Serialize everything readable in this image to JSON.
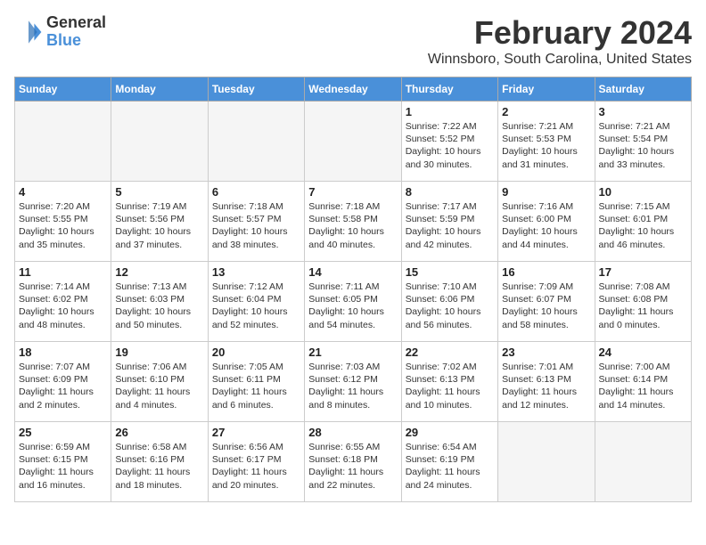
{
  "logo": {
    "general": "General",
    "blue": "Blue"
  },
  "title": "February 2024",
  "subtitle": "Winnsboro, South Carolina, United States",
  "days_header": [
    "Sunday",
    "Monday",
    "Tuesday",
    "Wednesday",
    "Thursday",
    "Friday",
    "Saturday"
  ],
  "weeks": [
    [
      {
        "num": "",
        "info": ""
      },
      {
        "num": "",
        "info": ""
      },
      {
        "num": "",
        "info": ""
      },
      {
        "num": "",
        "info": ""
      },
      {
        "num": "1",
        "info": "Sunrise: 7:22 AM\nSunset: 5:52 PM\nDaylight: 10 hours\nand 30 minutes."
      },
      {
        "num": "2",
        "info": "Sunrise: 7:21 AM\nSunset: 5:53 PM\nDaylight: 10 hours\nand 31 minutes."
      },
      {
        "num": "3",
        "info": "Sunrise: 7:21 AM\nSunset: 5:54 PM\nDaylight: 10 hours\nand 33 minutes."
      }
    ],
    [
      {
        "num": "4",
        "info": "Sunrise: 7:20 AM\nSunset: 5:55 PM\nDaylight: 10 hours\nand 35 minutes."
      },
      {
        "num": "5",
        "info": "Sunrise: 7:19 AM\nSunset: 5:56 PM\nDaylight: 10 hours\nand 37 minutes."
      },
      {
        "num": "6",
        "info": "Sunrise: 7:18 AM\nSunset: 5:57 PM\nDaylight: 10 hours\nand 38 minutes."
      },
      {
        "num": "7",
        "info": "Sunrise: 7:18 AM\nSunset: 5:58 PM\nDaylight: 10 hours\nand 40 minutes."
      },
      {
        "num": "8",
        "info": "Sunrise: 7:17 AM\nSunset: 5:59 PM\nDaylight: 10 hours\nand 42 minutes."
      },
      {
        "num": "9",
        "info": "Sunrise: 7:16 AM\nSunset: 6:00 PM\nDaylight: 10 hours\nand 44 minutes."
      },
      {
        "num": "10",
        "info": "Sunrise: 7:15 AM\nSunset: 6:01 PM\nDaylight: 10 hours\nand 46 minutes."
      }
    ],
    [
      {
        "num": "11",
        "info": "Sunrise: 7:14 AM\nSunset: 6:02 PM\nDaylight: 10 hours\nand 48 minutes."
      },
      {
        "num": "12",
        "info": "Sunrise: 7:13 AM\nSunset: 6:03 PM\nDaylight: 10 hours\nand 50 minutes."
      },
      {
        "num": "13",
        "info": "Sunrise: 7:12 AM\nSunset: 6:04 PM\nDaylight: 10 hours\nand 52 minutes."
      },
      {
        "num": "14",
        "info": "Sunrise: 7:11 AM\nSunset: 6:05 PM\nDaylight: 10 hours\nand 54 minutes."
      },
      {
        "num": "15",
        "info": "Sunrise: 7:10 AM\nSunset: 6:06 PM\nDaylight: 10 hours\nand 56 minutes."
      },
      {
        "num": "16",
        "info": "Sunrise: 7:09 AM\nSunset: 6:07 PM\nDaylight: 10 hours\nand 58 minutes."
      },
      {
        "num": "17",
        "info": "Sunrise: 7:08 AM\nSunset: 6:08 PM\nDaylight: 11 hours\nand 0 minutes."
      }
    ],
    [
      {
        "num": "18",
        "info": "Sunrise: 7:07 AM\nSunset: 6:09 PM\nDaylight: 11 hours\nand 2 minutes."
      },
      {
        "num": "19",
        "info": "Sunrise: 7:06 AM\nSunset: 6:10 PM\nDaylight: 11 hours\nand 4 minutes."
      },
      {
        "num": "20",
        "info": "Sunrise: 7:05 AM\nSunset: 6:11 PM\nDaylight: 11 hours\nand 6 minutes."
      },
      {
        "num": "21",
        "info": "Sunrise: 7:03 AM\nSunset: 6:12 PM\nDaylight: 11 hours\nand 8 minutes."
      },
      {
        "num": "22",
        "info": "Sunrise: 7:02 AM\nSunset: 6:13 PM\nDaylight: 11 hours\nand 10 minutes."
      },
      {
        "num": "23",
        "info": "Sunrise: 7:01 AM\nSunset: 6:13 PM\nDaylight: 11 hours\nand 12 minutes."
      },
      {
        "num": "24",
        "info": "Sunrise: 7:00 AM\nSunset: 6:14 PM\nDaylight: 11 hours\nand 14 minutes."
      }
    ],
    [
      {
        "num": "25",
        "info": "Sunrise: 6:59 AM\nSunset: 6:15 PM\nDaylight: 11 hours\nand 16 minutes."
      },
      {
        "num": "26",
        "info": "Sunrise: 6:58 AM\nSunset: 6:16 PM\nDaylight: 11 hours\nand 18 minutes."
      },
      {
        "num": "27",
        "info": "Sunrise: 6:56 AM\nSunset: 6:17 PM\nDaylight: 11 hours\nand 20 minutes."
      },
      {
        "num": "28",
        "info": "Sunrise: 6:55 AM\nSunset: 6:18 PM\nDaylight: 11 hours\nand 22 minutes."
      },
      {
        "num": "29",
        "info": "Sunrise: 6:54 AM\nSunset: 6:19 PM\nDaylight: 11 hours\nand 24 minutes."
      },
      {
        "num": "",
        "info": ""
      },
      {
        "num": "",
        "info": ""
      }
    ]
  ]
}
